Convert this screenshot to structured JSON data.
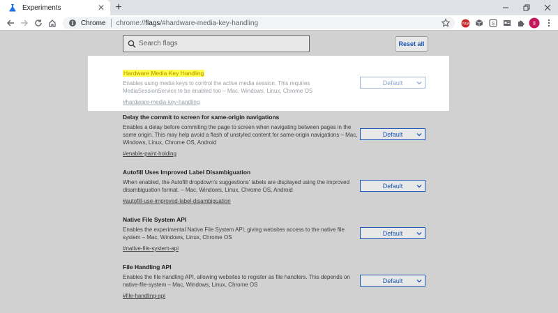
{
  "browser": {
    "tab_title": "Experiments",
    "new_tab_symbol": "+",
    "scheme_label": "Chrome",
    "url_prefix": "chrome://",
    "url_host": "flags",
    "url_path": "/#hardware-media-key-handling",
    "extensions": [
      "toxic-ext-icon",
      "cube-ext-icon",
      "s-ext-icon",
      "card-ext-icon",
      "puzzle-extensions-icon"
    ],
    "profile_initial": "ii",
    "accent_color": "#1a73e8"
  },
  "page": {
    "search_placeholder": "Search flags",
    "reset_label": "Reset all",
    "flags": [
      {
        "name": "Hardware Media Key Handling",
        "description": "Enables using media keys to control the active media session. This requires MediaSessionService to be enabled too – Mac, Windows, Linux, Chrome OS",
        "link": "#hardware-media-key-handling",
        "value": "Default",
        "highlighted": true
      },
      {
        "name": "Delay the commit to screen for same-origin navigations",
        "description": "Enables a delay before commiting the page to screen when navigating between pages in the same origin. This may help avoid a flash of unstyled content for same-origin navigations – Mac, Windows, Linux, Chrome OS, Android",
        "link": "#enable-paint-holding",
        "value": "Default"
      },
      {
        "name": "Autofill Uses Improved Label Disambiguation",
        "description": "When enabled, the Autofill dropdown's suggestions' labels are displayed using the improved disambiguation format. – Mac, Windows, Linux, Chrome OS, Android",
        "link": "#autofill-use-improved-label-disambiguation",
        "value": "Default"
      },
      {
        "name": "Native File System API",
        "description": "Enables the experimental Native File System API, giving websites access to the native file system – Mac, Windows, Linux, Chrome OS",
        "link": "#native-file-system-api",
        "value": "Default"
      },
      {
        "name": "File Handling API",
        "description": "Enables the file handling API, allowing websites to register as file handlers. This depends on native-file-system – Mac, Windows, Linux, Chrome OS",
        "link": "#file-handling-api",
        "value": "Default"
      }
    ]
  }
}
